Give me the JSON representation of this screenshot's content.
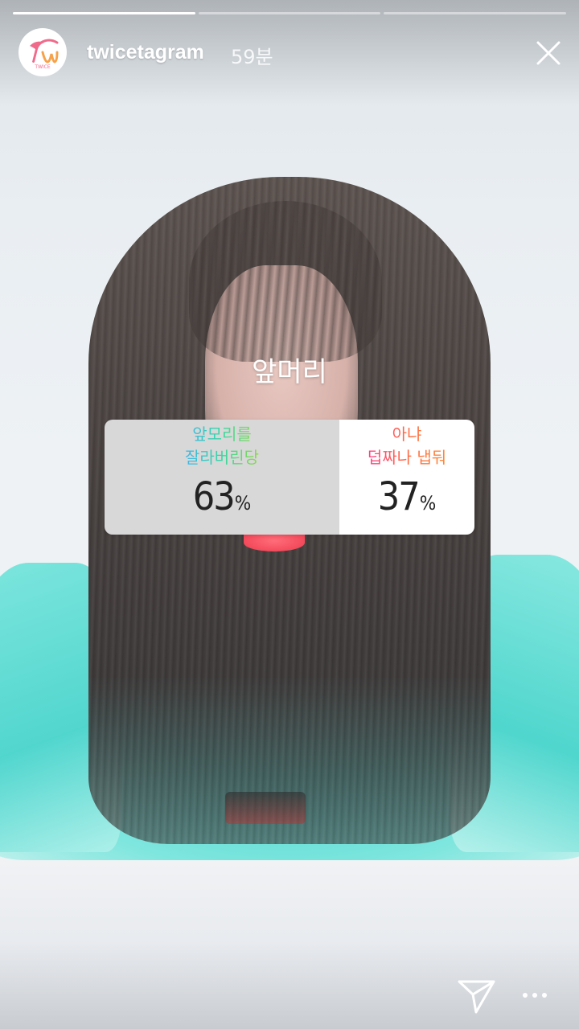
{
  "story": {
    "progress": [
      1.0,
      0.0,
      0.0
    ],
    "username": "twicetagram",
    "time_ago": "59분",
    "avatar_icon": "twice-logo-icon",
    "avatar_logo_text": "TWICE",
    "close_icon": "close-icon"
  },
  "poll": {
    "question": "앞머리",
    "options": [
      {
        "label_line1": "앞모리를",
        "label_line2": "잘라버린당",
        "percent": "63",
        "percent_sign": "%"
      },
      {
        "label_line1": "아냐",
        "label_line2": "덥짜나 냅둬",
        "percent": "37",
        "percent_sign": "%"
      }
    ]
  },
  "footer": {
    "send_icon": "send-icon",
    "more_icon": "more-options-icon"
  },
  "colors": {
    "accent_left_gradient": [
      "#3fb6e8",
      "#38d7a2",
      "#8fd84a"
    ],
    "accent_right_gradient": [
      "#ff3e87",
      "#ff6b45",
      "#ff8a3a"
    ],
    "logo": "#f06b8b"
  }
}
